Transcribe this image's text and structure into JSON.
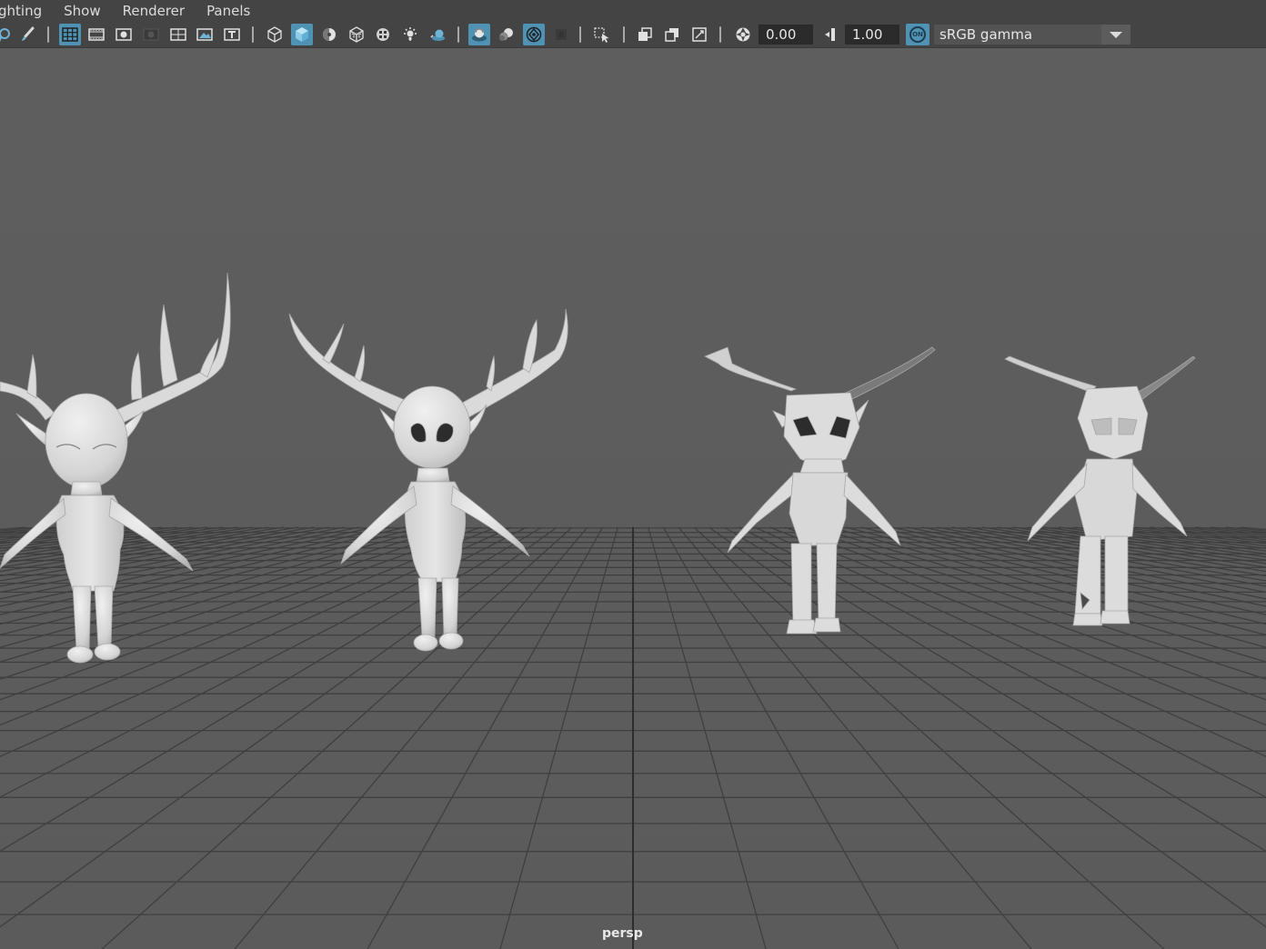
{
  "menu": {
    "items": [
      "ghting",
      "Show",
      "Renderer",
      "Panels"
    ]
  },
  "toolbar": {
    "exposure_value": "0.00",
    "gamma_value": "1.00",
    "view_transform_badge": "ON",
    "color_space": "sRGB gamma"
  },
  "viewport": {
    "camera_name": "persp"
  },
  "colors": {
    "chrome": "#444444",
    "viewport_bg": "#5d5d5d",
    "active_toggle": "#4f92b4",
    "grid_line": "#3f3f3f",
    "model": "#dcdcdc"
  }
}
